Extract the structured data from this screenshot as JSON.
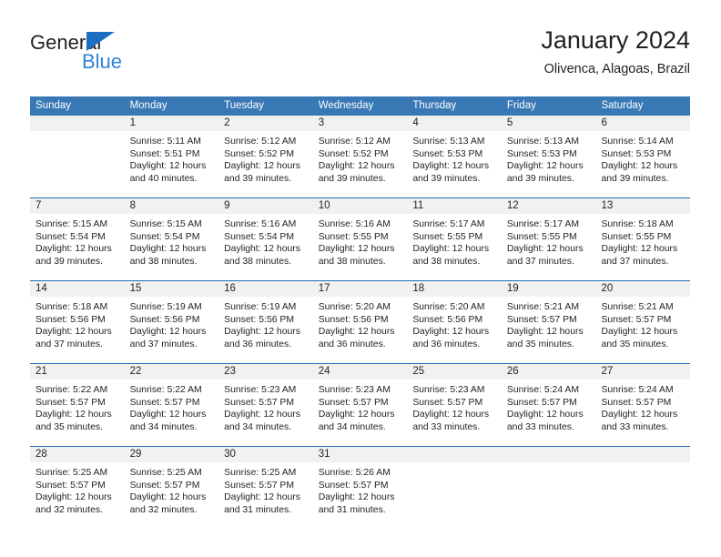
{
  "brand": {
    "name_part1": "General",
    "name_part2": "Blue",
    "accent_color": "#2e84d6",
    "triangle_color": "#1b6ec2"
  },
  "header": {
    "title": "January 2024",
    "subtitle": "Olivenca, Alagoas, Brazil",
    "header_bg": "#3878b4",
    "row_rule_color": "#1f6cb0",
    "daynum_bg": "#f1f1f1"
  },
  "weekdays": [
    "Sunday",
    "Monday",
    "Tuesday",
    "Wednesday",
    "Thursday",
    "Friday",
    "Saturday"
  ],
  "weeks": [
    [
      {
        "day": "",
        "sunrise": "",
        "sunset": "",
        "daylight1": "",
        "daylight2": ""
      },
      {
        "day": "1",
        "sunrise": "Sunrise: 5:11 AM",
        "sunset": "Sunset: 5:51 PM",
        "daylight1": "Daylight: 12 hours",
        "daylight2": "and 40 minutes."
      },
      {
        "day": "2",
        "sunrise": "Sunrise: 5:12 AM",
        "sunset": "Sunset: 5:52 PM",
        "daylight1": "Daylight: 12 hours",
        "daylight2": "and 39 minutes."
      },
      {
        "day": "3",
        "sunrise": "Sunrise: 5:12 AM",
        "sunset": "Sunset: 5:52 PM",
        "daylight1": "Daylight: 12 hours",
        "daylight2": "and 39 minutes."
      },
      {
        "day": "4",
        "sunrise": "Sunrise: 5:13 AM",
        "sunset": "Sunset: 5:53 PM",
        "daylight1": "Daylight: 12 hours",
        "daylight2": "and 39 minutes."
      },
      {
        "day": "5",
        "sunrise": "Sunrise: 5:13 AM",
        "sunset": "Sunset: 5:53 PM",
        "daylight1": "Daylight: 12 hours",
        "daylight2": "and 39 minutes."
      },
      {
        "day": "6",
        "sunrise": "Sunrise: 5:14 AM",
        "sunset": "Sunset: 5:53 PM",
        "daylight1": "Daylight: 12 hours",
        "daylight2": "and 39 minutes."
      }
    ],
    [
      {
        "day": "7",
        "sunrise": "Sunrise: 5:15 AM",
        "sunset": "Sunset: 5:54 PM",
        "daylight1": "Daylight: 12 hours",
        "daylight2": "and 39 minutes."
      },
      {
        "day": "8",
        "sunrise": "Sunrise: 5:15 AM",
        "sunset": "Sunset: 5:54 PM",
        "daylight1": "Daylight: 12 hours",
        "daylight2": "and 38 minutes."
      },
      {
        "day": "9",
        "sunrise": "Sunrise: 5:16 AM",
        "sunset": "Sunset: 5:54 PM",
        "daylight1": "Daylight: 12 hours",
        "daylight2": "and 38 minutes."
      },
      {
        "day": "10",
        "sunrise": "Sunrise: 5:16 AM",
        "sunset": "Sunset: 5:55 PM",
        "daylight1": "Daylight: 12 hours",
        "daylight2": "and 38 minutes."
      },
      {
        "day": "11",
        "sunrise": "Sunrise: 5:17 AM",
        "sunset": "Sunset: 5:55 PM",
        "daylight1": "Daylight: 12 hours",
        "daylight2": "and 38 minutes."
      },
      {
        "day": "12",
        "sunrise": "Sunrise: 5:17 AM",
        "sunset": "Sunset: 5:55 PM",
        "daylight1": "Daylight: 12 hours",
        "daylight2": "and 37 minutes."
      },
      {
        "day": "13",
        "sunrise": "Sunrise: 5:18 AM",
        "sunset": "Sunset: 5:55 PM",
        "daylight1": "Daylight: 12 hours",
        "daylight2": "and 37 minutes."
      }
    ],
    [
      {
        "day": "14",
        "sunrise": "Sunrise: 5:18 AM",
        "sunset": "Sunset: 5:56 PM",
        "daylight1": "Daylight: 12 hours",
        "daylight2": "and 37 minutes."
      },
      {
        "day": "15",
        "sunrise": "Sunrise: 5:19 AM",
        "sunset": "Sunset: 5:56 PM",
        "daylight1": "Daylight: 12 hours",
        "daylight2": "and 37 minutes."
      },
      {
        "day": "16",
        "sunrise": "Sunrise: 5:19 AM",
        "sunset": "Sunset: 5:56 PM",
        "daylight1": "Daylight: 12 hours",
        "daylight2": "and 36 minutes."
      },
      {
        "day": "17",
        "sunrise": "Sunrise: 5:20 AM",
        "sunset": "Sunset: 5:56 PM",
        "daylight1": "Daylight: 12 hours",
        "daylight2": "and 36 minutes."
      },
      {
        "day": "18",
        "sunrise": "Sunrise: 5:20 AM",
        "sunset": "Sunset: 5:56 PM",
        "daylight1": "Daylight: 12 hours",
        "daylight2": "and 36 minutes."
      },
      {
        "day": "19",
        "sunrise": "Sunrise: 5:21 AM",
        "sunset": "Sunset: 5:57 PM",
        "daylight1": "Daylight: 12 hours",
        "daylight2": "and 35 minutes."
      },
      {
        "day": "20",
        "sunrise": "Sunrise: 5:21 AM",
        "sunset": "Sunset: 5:57 PM",
        "daylight1": "Daylight: 12 hours",
        "daylight2": "and 35 minutes."
      }
    ],
    [
      {
        "day": "21",
        "sunrise": "Sunrise: 5:22 AM",
        "sunset": "Sunset: 5:57 PM",
        "daylight1": "Daylight: 12 hours",
        "daylight2": "and 35 minutes."
      },
      {
        "day": "22",
        "sunrise": "Sunrise: 5:22 AM",
        "sunset": "Sunset: 5:57 PM",
        "daylight1": "Daylight: 12 hours",
        "daylight2": "and 34 minutes."
      },
      {
        "day": "23",
        "sunrise": "Sunrise: 5:23 AM",
        "sunset": "Sunset: 5:57 PM",
        "daylight1": "Daylight: 12 hours",
        "daylight2": "and 34 minutes."
      },
      {
        "day": "24",
        "sunrise": "Sunrise: 5:23 AM",
        "sunset": "Sunset: 5:57 PM",
        "daylight1": "Daylight: 12 hours",
        "daylight2": "and 34 minutes."
      },
      {
        "day": "25",
        "sunrise": "Sunrise: 5:23 AM",
        "sunset": "Sunset: 5:57 PM",
        "daylight1": "Daylight: 12 hours",
        "daylight2": "and 33 minutes."
      },
      {
        "day": "26",
        "sunrise": "Sunrise: 5:24 AM",
        "sunset": "Sunset: 5:57 PM",
        "daylight1": "Daylight: 12 hours",
        "daylight2": "and 33 minutes."
      },
      {
        "day": "27",
        "sunrise": "Sunrise: 5:24 AM",
        "sunset": "Sunset: 5:57 PM",
        "daylight1": "Daylight: 12 hours",
        "daylight2": "and 33 minutes."
      }
    ],
    [
      {
        "day": "28",
        "sunrise": "Sunrise: 5:25 AM",
        "sunset": "Sunset: 5:57 PM",
        "daylight1": "Daylight: 12 hours",
        "daylight2": "and 32 minutes."
      },
      {
        "day": "29",
        "sunrise": "Sunrise: 5:25 AM",
        "sunset": "Sunset: 5:57 PM",
        "daylight1": "Daylight: 12 hours",
        "daylight2": "and 32 minutes."
      },
      {
        "day": "30",
        "sunrise": "Sunrise: 5:25 AM",
        "sunset": "Sunset: 5:57 PM",
        "daylight1": "Daylight: 12 hours",
        "daylight2": "and 31 minutes."
      },
      {
        "day": "31",
        "sunrise": "Sunrise: 5:26 AM",
        "sunset": "Sunset: 5:57 PM",
        "daylight1": "Daylight: 12 hours",
        "daylight2": "and 31 minutes."
      },
      {
        "day": "",
        "sunrise": "",
        "sunset": "",
        "daylight1": "",
        "daylight2": ""
      },
      {
        "day": "",
        "sunrise": "",
        "sunset": "",
        "daylight1": "",
        "daylight2": ""
      },
      {
        "day": "",
        "sunrise": "",
        "sunset": "",
        "daylight1": "",
        "daylight2": ""
      }
    ]
  ]
}
